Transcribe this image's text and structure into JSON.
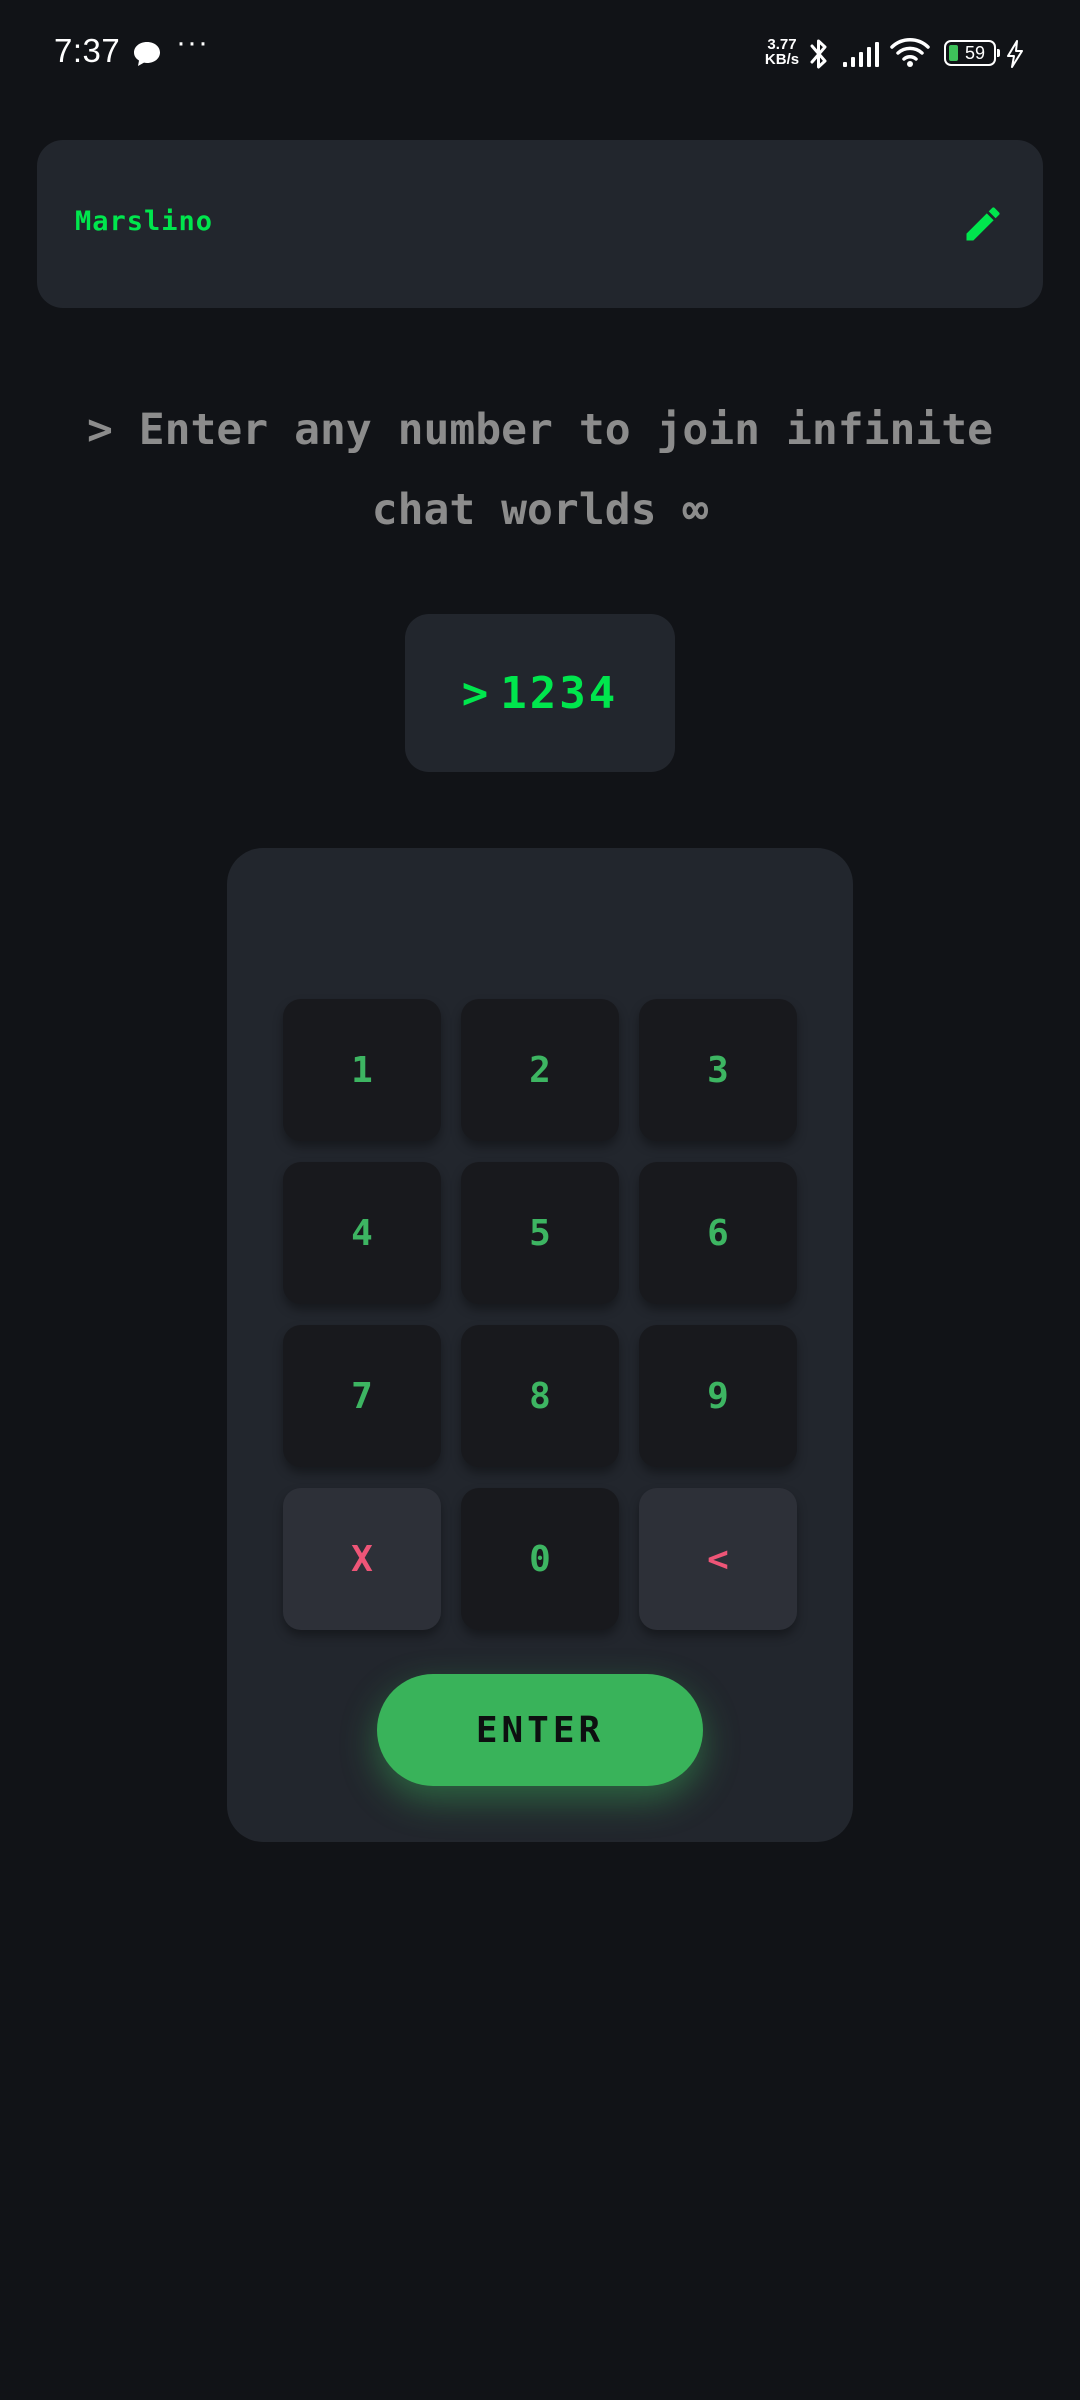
{
  "status_bar": {
    "time": "7:37",
    "overflow": "···",
    "net_speed_value": "3.77",
    "net_speed_unit": "KB/s",
    "battery_level": "59",
    "icons": [
      "message-icon",
      "bluetooth-icon",
      "signal-icon",
      "wifi-icon",
      "battery-icon",
      "charging-icon"
    ]
  },
  "profile": {
    "name": "Marslino",
    "edit_icon": "pencil-icon"
  },
  "prompt": {
    "chevron": ">",
    "text": "Enter any number to join infinite chat worlds ∞"
  },
  "code_display": {
    "chevron": ">",
    "value": "1234"
  },
  "keypad": {
    "keys": [
      "1",
      "2",
      "3",
      "4",
      "5",
      "6",
      "7",
      "8",
      "9",
      "X",
      "0",
      "<"
    ],
    "enter_label": "ENTER"
  },
  "colors": {
    "background": "#111317",
    "card": "#22262d",
    "key": "#18191d",
    "key_util": "#2d3038",
    "accent_green": "#00e64d",
    "key_digit": "#3db562",
    "key_util_text": "#ee5577",
    "enter_button": "#39b35a",
    "muted_text": "#8c8c8c"
  }
}
